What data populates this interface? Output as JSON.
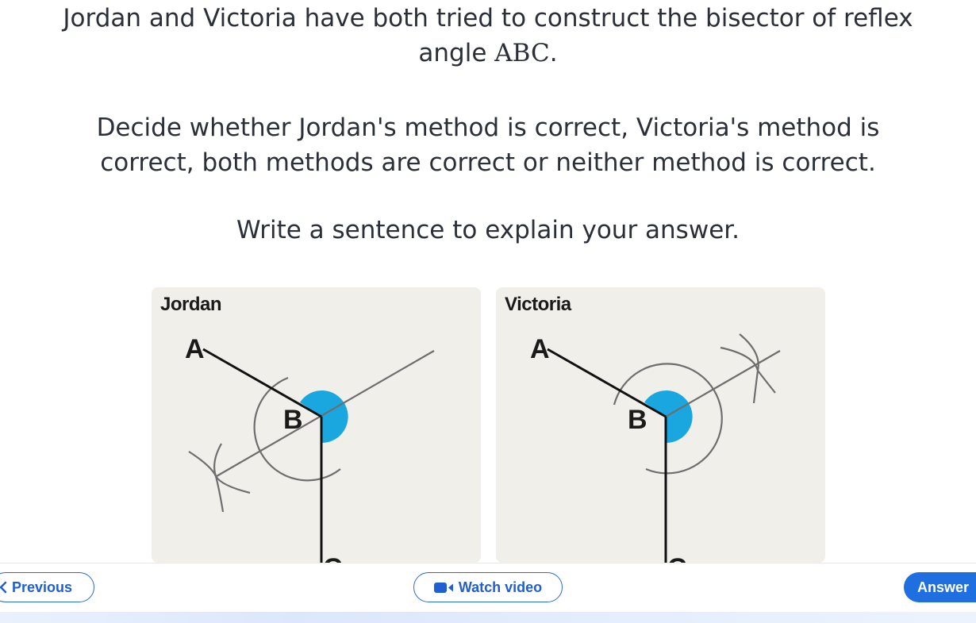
{
  "question": {
    "line1_pre": "Jordan and Victoria have both tried to construct the bisector of reflex",
    "line2_pre": "angle ",
    "line2_math": "ABC",
    "line2_post": ".",
    "decide_line1": "Decide whether Jordan's method is correct, Victoria's method is",
    "decide_line2": "correct, both methods are correct or neither method is correct.",
    "explain": "Write a sentence to explain your answer."
  },
  "panels": {
    "jordan": {
      "title": "Jordan",
      "label_a": "A",
      "label_b": "B",
      "label_c": "C"
    },
    "victoria": {
      "title": "Victoria",
      "label_a": "A",
      "label_b": "B",
      "label_c": "C"
    }
  },
  "colors": {
    "panel_bg": "#f1efea",
    "angle_fill": "#1aa7e0",
    "construction_line": "#6e6e6e",
    "arm_line": "#111111",
    "primary": "#1f6fe0"
  },
  "nav": {
    "previous_label": "Previous",
    "previous_icon": "chevron-left-icon",
    "watch_video_label": "Watch video",
    "watch_video_icon": "video-camera-icon",
    "answer_label": "Answer"
  }
}
